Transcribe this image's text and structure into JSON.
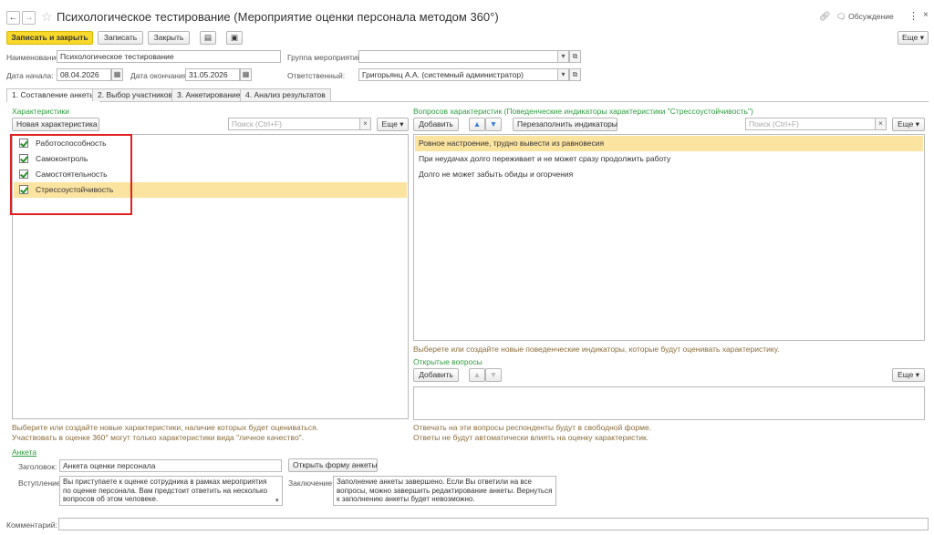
{
  "window": {
    "title": "Психологическое тестирование (Мероприятие оценки персонала методом 360°)",
    "discussion_label": "Обсуждение",
    "more_menu": "⋮"
  },
  "toolbar": {
    "save_close": "Записать и закрыть",
    "save": "Записать",
    "close": "Закрыть",
    "more": "Еще ▾"
  },
  "form": {
    "name_label": "Наименование:",
    "name_value": "Психологическое тестирование",
    "group_label": "Группа мероприятий:",
    "group_value": "",
    "start_label": "Дата начала:",
    "start_value": "08.04.2026",
    "end_label": "Дата окончания:",
    "end_value": "31.05.2026",
    "resp_label": "Ответственный:",
    "resp_value": "Григорьянц А.А. (системный администратор)"
  },
  "tabs": [
    {
      "label": "1. Составление анкеты"
    },
    {
      "label": "2. Выбор участников"
    },
    {
      "label": "3. Анкетирование"
    },
    {
      "label": "4. Анализ результатов"
    }
  ],
  "characteristics": {
    "title": "Характеристики",
    "new_button": "Новая характеристика",
    "search_placeholder": "Поиск (Ctrl+F)",
    "more": "Еще ▾",
    "items": [
      {
        "label": "Работоспособность",
        "checked": true
      },
      {
        "label": "Самоконтроль",
        "checked": true
      },
      {
        "label": "Самостоятельность",
        "checked": true
      },
      {
        "label": "Стрессоустойчивость",
        "checked": true
      }
    ],
    "hint_line1": "Выберите или создайте новые характеристики, наличие которых будет оцениваться.",
    "hint_line2": "Участвовать в оценке 360° могут только характеристики вида \"личное качество\"."
  },
  "questions": {
    "title": "Вопросов характеристик (Поведенческие индикаторы характеристики \"Стрессоустойчивость\")",
    "add_button": "Добавить",
    "refill_button": "Перезаполнить индикаторы",
    "search_placeholder": "Поиск (Ctrl+F)",
    "more": "Еще ▾",
    "items": [
      {
        "label": "Ровное настроение, трудно вывести из равновесия"
      },
      {
        "label": "При неудачах долго переживает и не может сразу продолжить работу"
      },
      {
        "label": "Долго не может забыть обиды и огорчения"
      }
    ],
    "hint": "Выберете или создайте новые поведенческие индикаторы, которые будут оценивать характеристику."
  },
  "open_questions": {
    "title": "Открытые вопросы",
    "add_button": "Добавить",
    "more": "Еще ▾",
    "hint_line1": "Отвечать на эти вопросы респонденты будут в свободной форме.",
    "hint_line2": "Ответы не будут автоматически влиять на оценку характеристик."
  },
  "survey": {
    "section_label": "Анкета",
    "header_label": "Заголовок:",
    "header_value": "Анкета оценки персонала",
    "open_form_button": "Открыть форму анкеты",
    "intro_label": "Вступление:",
    "intro_text": "Вы приступаете к оценке сотрудника в рамках мероприятия по оценке персонала. Вам предстоит ответить на несколько вопросов об этом человеке.",
    "conclusion_label": "Заключение:",
    "conclusion_text": "Заполнение анкеты завершено. Если Вы ответили на все вопросы, можно завершить редактирование анкеты. Вернуться к заполнению анкеты будет невозможно."
  },
  "comment": {
    "label": "Комментарий:",
    "value": ""
  },
  "colors": {
    "accent_yellow": "#f7d82b",
    "selection": "#fbe3a0",
    "section_green": "#2f9e3f",
    "hint_brown": "#8a6d3b",
    "highlight_red": "#e02020"
  }
}
